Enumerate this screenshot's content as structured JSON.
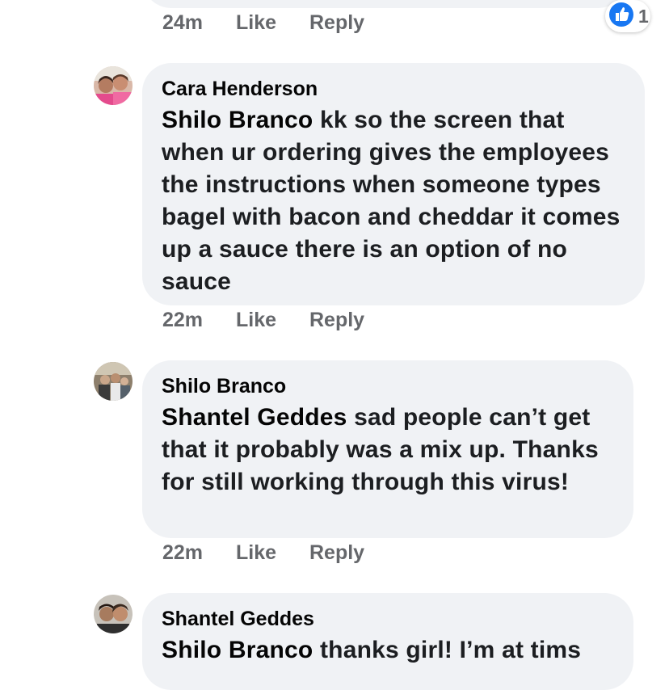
{
  "previous_comment": {
    "time": "24m",
    "like_label": "Like",
    "reply_label": "Reply",
    "reaction": {
      "icon": "thumbs-up-icon",
      "count": "1",
      "color": "#1877f2"
    }
  },
  "comments": [
    {
      "author": "Cara Henderson",
      "mention": "Shilo Branco",
      "text": " kk so the screen that when ur ordering gives the employees the instructions when someone types bagel with bacon and cheddar it comes up a sauce there is an option of no sauce",
      "time": "22m",
      "like_label": "Like",
      "reply_label": "Reply"
    },
    {
      "author": "Shilo Branco",
      "mention": "Shantel Geddes",
      "text": "  sad people can’t get that it probably was a mix up. Thanks for still working through this virus!",
      "time": "22m",
      "like_label": "Like",
      "reply_label": "Reply"
    },
    {
      "author": "Shantel Geddes",
      "mention": "Shilo Branco",
      "text": " thanks girl! I’m at tims"
    }
  ],
  "colors": {
    "bubble_bg": "#f0f2f5",
    "meta_text": "#65676b",
    "accent": "#1877f2"
  }
}
